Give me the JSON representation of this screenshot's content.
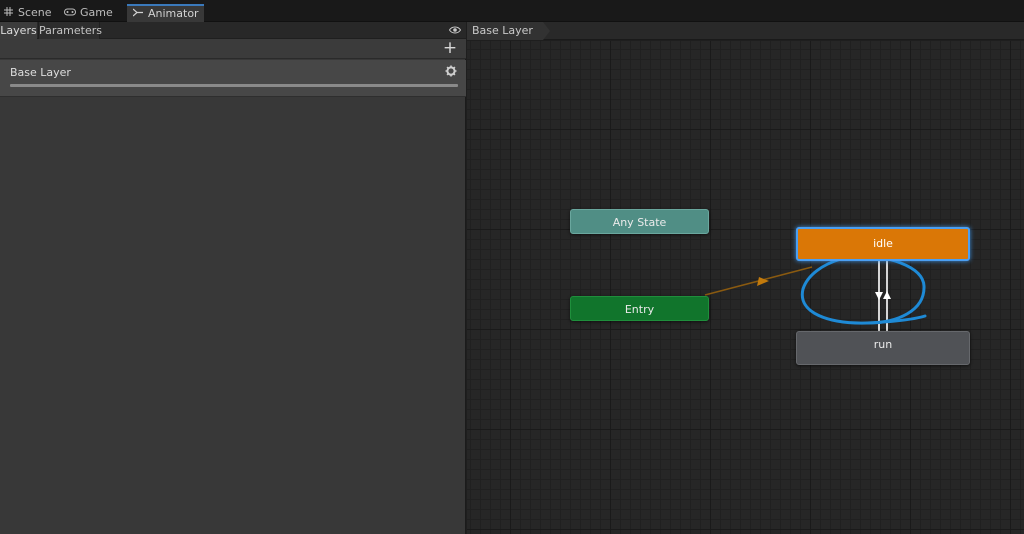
{
  "tabs": [
    {
      "label": "Scene",
      "icon": "grid-icon"
    },
    {
      "label": "Game",
      "icon": "gamepad-icon"
    },
    {
      "label": "Animator",
      "icon": "animator-icon"
    }
  ],
  "left_panel": {
    "tabs": [
      "Layers",
      "Parameters"
    ],
    "layer": {
      "name": "Base Layer"
    }
  },
  "graph": {
    "breadcrumb": "Base Layer",
    "nodes": {
      "any_state": "Any State",
      "entry": "Entry",
      "idle": "idle",
      "run": "run"
    }
  },
  "colors": {
    "accent": "#3a79bb",
    "default_state": "#da7706",
    "entry": "#11752c",
    "any_state": "#508e85",
    "state": "#505256",
    "annotation": "#1e8ad6"
  }
}
